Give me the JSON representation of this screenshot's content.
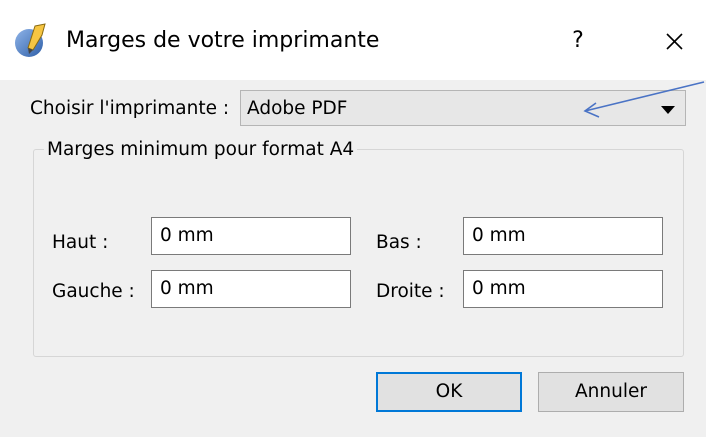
{
  "window": {
    "title": "Marges de votre imprimante",
    "help_glyph": "?",
    "icon": "app-icon",
    "close_icon": "close-icon"
  },
  "printer": {
    "label": "Choisir l'imprimante :",
    "selected": "Adobe PDF",
    "dropdown_icon": "dropdown-arrow-icon"
  },
  "margins": {
    "group_title": "Marges minimum pour format A4",
    "top_label": "Haut :",
    "top_value": "0 mm",
    "bottom_label": "Bas :",
    "bottom_value": "0 mm",
    "left_label": "Gauche :",
    "left_value": "0 mm",
    "right_label": "Droite :",
    "right_value": "0 mm"
  },
  "buttons": {
    "ok": "OK",
    "cancel": "Annuler"
  },
  "colors": {
    "annotation_arrow": "#4a73c5",
    "default_button_border": "#0078d7"
  }
}
